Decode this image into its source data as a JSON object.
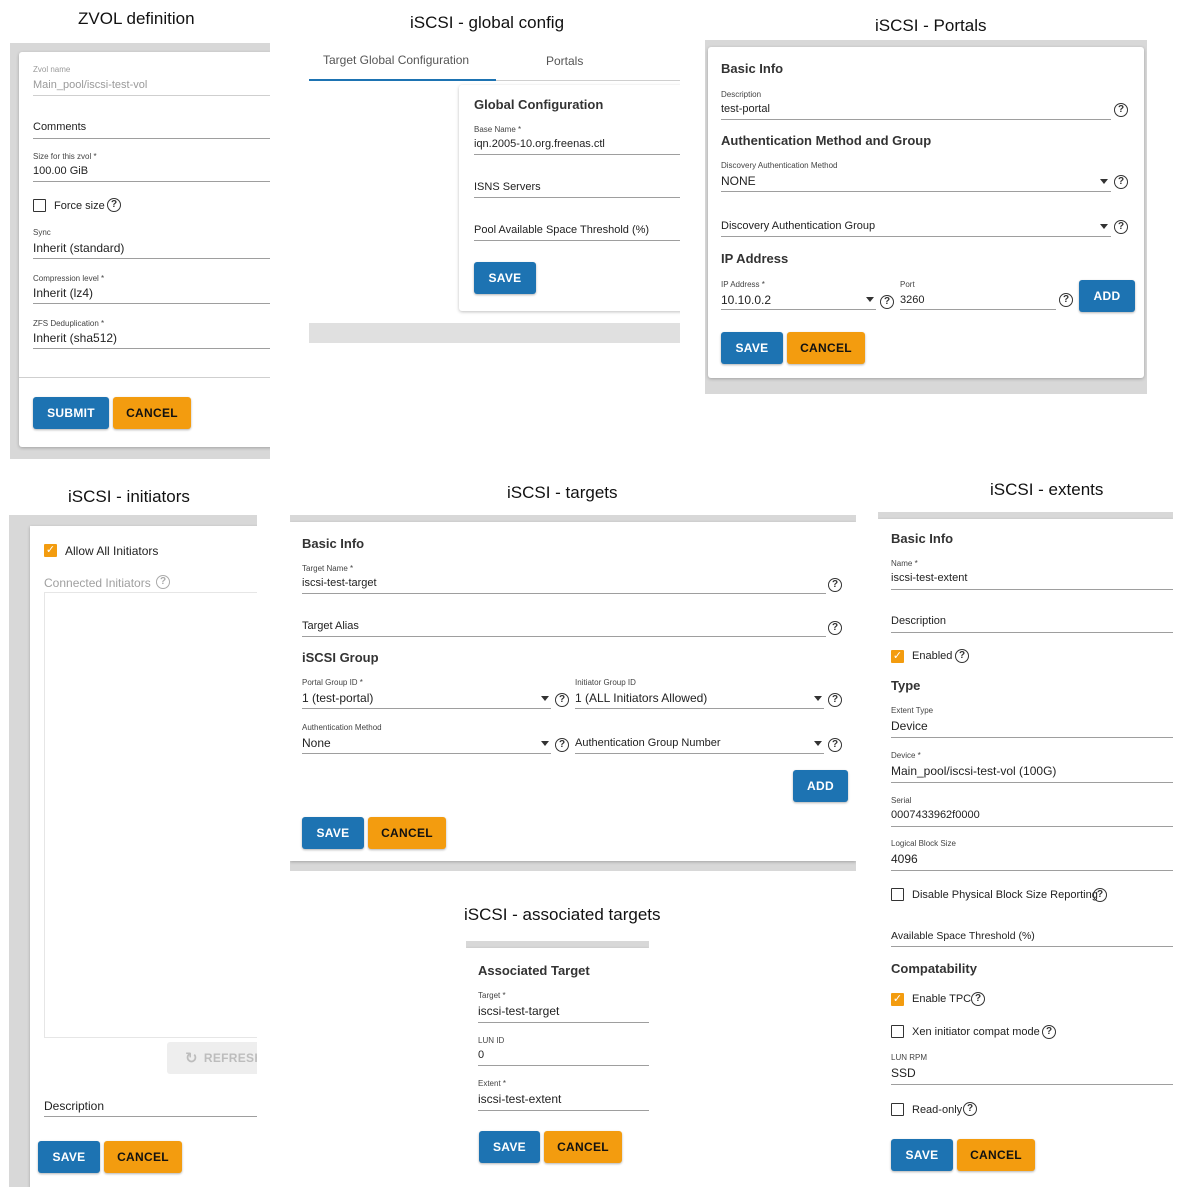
{
  "captions": {
    "zvol": "ZVOL definition",
    "global": "iSCSI - global config",
    "portals": "iSCSI - Portals",
    "initiators": "iSCSI - initiators",
    "targets": "iSCSI - targets",
    "extents": "iSCSI - extents",
    "associated": "iSCSI - associated targets"
  },
  "zvol": {
    "name_label": "Zvol name",
    "name_value": "Main_pool/iscsi-test-vol",
    "comments_label": "Comments",
    "size_label": "Size for this zvol *",
    "size_value": "100.00 GiB",
    "force_size_label": "Force size",
    "sync_label": "Sync",
    "sync_value": "Inherit (standard)",
    "compression_label": "Compression level *",
    "compression_value": "Inherit (lz4)",
    "dedup_label": "ZFS Deduplication *",
    "dedup_value": "Inherit (sha512)",
    "submit": "SUBMIT",
    "cancel": "CANCEL"
  },
  "global": {
    "tabs": [
      "Target Global Configuration",
      "Portals"
    ],
    "section": "Global Configuration",
    "base_name_label": "Base Name *",
    "base_name_value": "iqn.2005-10.org.freenas.ctl",
    "isns_label": "ISNS Servers",
    "threshold_label": "Pool Available Space Threshold (%)",
    "save": "SAVE"
  },
  "portals": {
    "basic_info": "Basic Info",
    "description_label": "Description",
    "description_value": "test-portal",
    "auth_section": "Authentication Method and Group",
    "disc_auth_method_label": "Discovery Authentication Method",
    "disc_auth_method_value": "NONE",
    "disc_auth_group_label": "Discovery Authentication Group",
    "ip_section": "IP Address",
    "ip_label": "IP Address *",
    "ip_value": "10.10.0.2",
    "port_label": "Port",
    "port_value": "3260",
    "add": "ADD",
    "save": "SAVE",
    "cancel": "CANCEL"
  },
  "initiators": {
    "allow_all_label": "Allow All Initiators",
    "connected_label": "Connected Initiators",
    "refresh": "REFRESH",
    "description_label": "Description",
    "save": "SAVE",
    "cancel": "CANCEL"
  },
  "targets": {
    "basic_info": "Basic Info",
    "target_name_label": "Target Name *",
    "target_name_value": "iscsi-test-target",
    "target_alias_label": "Target Alias",
    "group_section": "iSCSI Group",
    "portal_group_label": "Portal Group ID *",
    "portal_group_value": "1 (test-portal)",
    "initiator_group_label": "Initiator Group ID",
    "initiator_group_value": "1 (ALL Initiators Allowed)",
    "auth_method_label": "Authentication Method",
    "auth_method_value": "None",
    "auth_group_label": "Authentication Group Number",
    "add": "ADD",
    "save": "SAVE",
    "cancel": "CANCEL"
  },
  "associated": {
    "section": "Associated Target",
    "target_label": "Target *",
    "target_value": "iscsi-test-target",
    "lun_label": "LUN ID",
    "lun_value": "0",
    "extent_label": "Extent *",
    "extent_value": "iscsi-test-extent",
    "save": "SAVE",
    "cancel": "CANCEL"
  },
  "extents": {
    "basic_info": "Basic Info",
    "name_label": "Name *",
    "name_value": "iscsi-test-extent",
    "description_label": "Description",
    "enabled_label": "Enabled",
    "type_section": "Type",
    "extent_type_label": "Extent Type",
    "extent_type_value": "Device",
    "device_label": "Device *",
    "device_value": "Main_pool/iscsi-test-vol (100G)",
    "serial_label": "Serial",
    "serial_value": "0007433962f0000",
    "block_size_label": "Logical Block Size",
    "block_size_value": "4096",
    "disable_phys_label": "Disable Physical Block Size Reporting",
    "avail_threshold_label": "Available Space Threshold (%)",
    "compat_section": "Compatability",
    "enable_tpc_label": "Enable TPC",
    "xen_label": "Xen initiator compat mode",
    "lun_rpm_label": "LUN RPM",
    "lun_rpm_value": "SSD",
    "readonly_label": "Read-only",
    "save": "SAVE",
    "cancel": "CANCEL"
  },
  "colors": {
    "primary": "#1d73b2",
    "accent": "#f39c0f",
    "panel_bg": "#d8d8d8"
  }
}
